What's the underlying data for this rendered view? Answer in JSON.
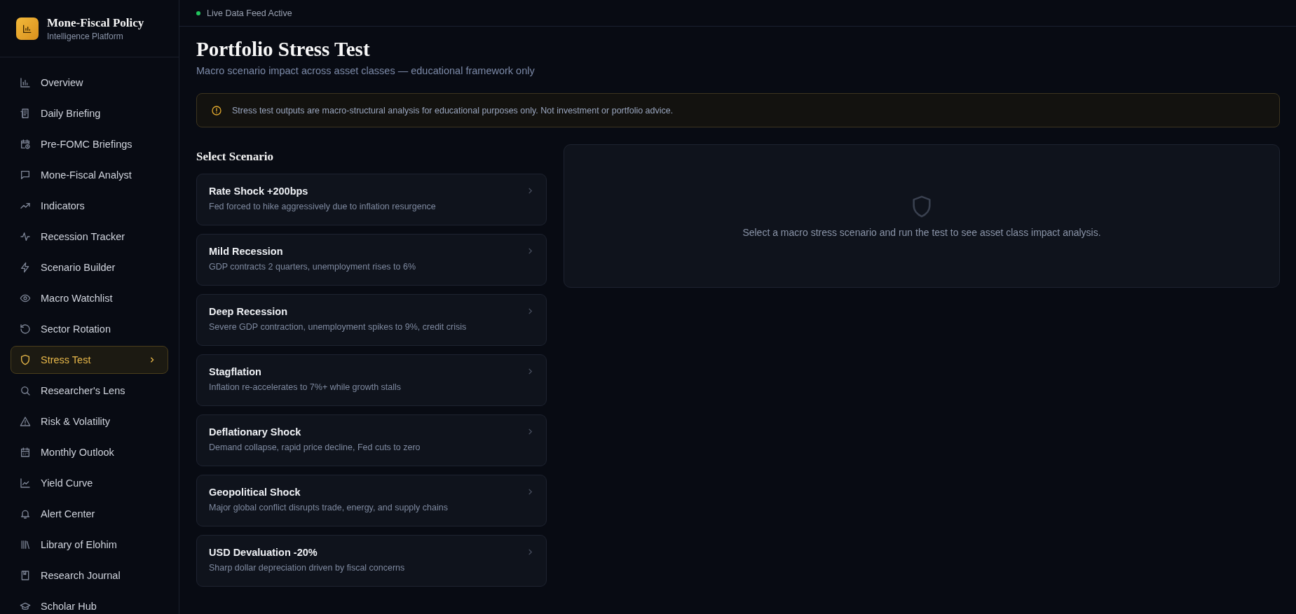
{
  "brand": {
    "title": "Mone-Fiscal Policy",
    "subtitle": "Intelligence Platform"
  },
  "sidebar": {
    "items": [
      {
        "label": "Overview",
        "kind": "bars",
        "selected": false
      },
      {
        "label": "Daily Briefing",
        "kind": "newspaper",
        "selected": false
      },
      {
        "label": "Pre-FOMC Briefings",
        "kind": "calendar-clock",
        "selected": false
      },
      {
        "label": "Mone-Fiscal Analyst",
        "kind": "chat",
        "selected": false
      },
      {
        "label": "Indicators",
        "kind": "trend",
        "selected": false
      },
      {
        "label": "Recession Tracker",
        "kind": "pulse",
        "selected": false
      },
      {
        "label": "Scenario Builder",
        "kind": "bolt",
        "selected": false
      },
      {
        "label": "Macro Watchlist",
        "kind": "eye",
        "selected": false
      },
      {
        "label": "Sector Rotation",
        "kind": "rotate",
        "selected": false
      },
      {
        "label": "Stress Test",
        "kind": "shield",
        "selected": true
      },
      {
        "label": "Researcher's Lens",
        "kind": "search",
        "selected": false
      },
      {
        "label": "Risk & Volatility",
        "kind": "warning",
        "selected": false
      },
      {
        "label": "Monthly Outlook",
        "kind": "calendar",
        "selected": false
      },
      {
        "label": "Yield Curve",
        "kind": "line-chart",
        "selected": false
      },
      {
        "label": "Alert Center",
        "kind": "bell",
        "selected": false
      },
      {
        "label": "Library of Elohim",
        "kind": "library",
        "selected": false
      },
      {
        "label": "Research Journal",
        "kind": "book",
        "selected": false
      },
      {
        "label": "Scholar Hub",
        "kind": "cap",
        "selected": false
      }
    ]
  },
  "status_bar": {
    "text": "Live Data Feed Active"
  },
  "page": {
    "title": "Portfolio Stress Test",
    "subtitle": "Macro scenario impact across asset classes — educational framework only"
  },
  "notice": "Stress test outputs are macro-structural analysis for educational purposes only. Not investment or portfolio advice.",
  "scenarios": {
    "heading": "Select Scenario",
    "items": [
      {
        "title": "Rate Shock +200bps",
        "description": "Fed forced to hike aggressively due to inflation resurgence"
      },
      {
        "title": "Mild Recession",
        "description": "GDP contracts 2 quarters, unemployment rises to 6%"
      },
      {
        "title": "Deep Recession",
        "description": "Severe GDP contraction, unemployment spikes to 9%, credit crisis"
      },
      {
        "title": "Stagflation",
        "description": "Inflation re-accelerates to 7%+ while growth stalls"
      },
      {
        "title": "Deflationary Shock",
        "description": "Demand collapse, rapid price decline, Fed cuts to zero"
      },
      {
        "title": "Geopolitical Shock",
        "description": "Major global conflict disrupts trade, energy, and supply chains"
      },
      {
        "title": "USD Devaluation -20%",
        "description": "Sharp dollar depreciation driven by fiscal concerns"
      }
    ]
  },
  "results": {
    "empty_message": "Select a macro stress scenario and run the test to see asset class impact analysis."
  }
}
